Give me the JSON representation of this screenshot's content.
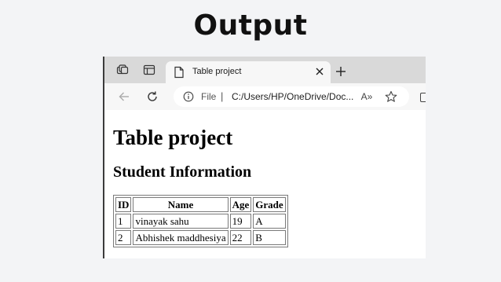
{
  "banner": {
    "title": "Output"
  },
  "browser": {
    "tab": {
      "title": "Table project"
    },
    "address": {
      "scheme_label": "File",
      "separator": "|",
      "url": "C:/Users/HP/OneDrive/Doc..."
    },
    "icons": {
      "workspaces": "workspaces-icon",
      "vertical_tabs": "vertical-tabs-icon",
      "tab_page": "page-icon",
      "close_tab": "close-icon",
      "new_tab": "plus-icon",
      "back": "back-arrow-icon",
      "refresh": "refresh-icon",
      "info": "info-icon",
      "read_aloud": "read-aloud-icon",
      "favorites": "star-icon"
    },
    "read_aloud_label": "A»"
  },
  "page": {
    "heading": "Table project",
    "subheading": "Student Information",
    "table": {
      "headers": [
        "ID",
        "Name",
        "Age",
        "Grade"
      ],
      "rows": [
        [
          "1",
          "vinayak sahu",
          "19",
          "A"
        ],
        [
          "2",
          "Abhishek maddhesiya",
          "22",
          "B"
        ]
      ]
    }
  }
}
